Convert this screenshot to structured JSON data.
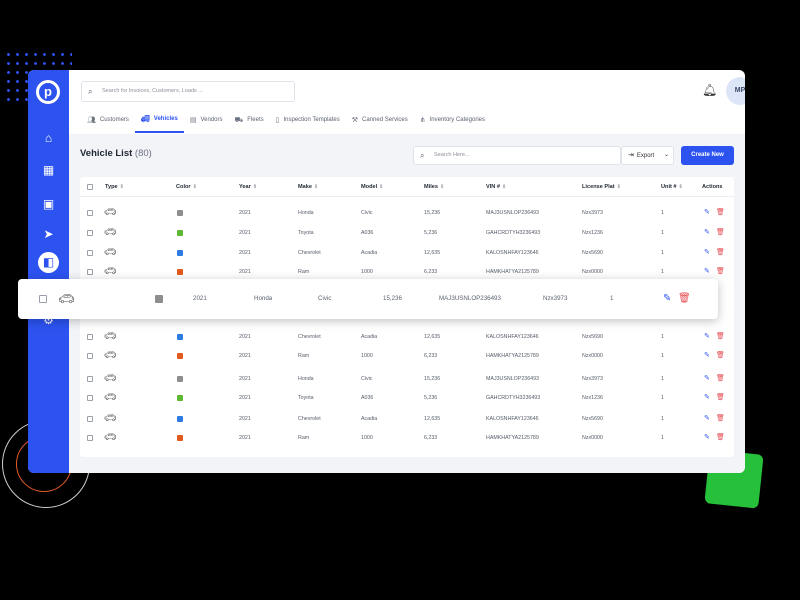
{
  "search": {
    "placeholder": "Search for Invoices, Customers, Loads ..."
  },
  "header": {
    "avatar_initials": "MP"
  },
  "tabs": [
    {
      "label": "Customers",
      "icon": "customers-icon"
    },
    {
      "label": "Vehicles",
      "icon": "vehicle-icon"
    },
    {
      "label": "Vendors",
      "icon": "vendors-icon"
    },
    {
      "label": "Fleets",
      "icon": "fleets-icon"
    },
    {
      "label": "Inspection Templates",
      "icon": "clipboard-icon"
    },
    {
      "label": "Canned Services",
      "icon": "services-icon"
    },
    {
      "label": "Inventory Categories",
      "icon": "categories-icon"
    }
  ],
  "main": {
    "title": "Vehicle List",
    "count": "(80)",
    "search_placeholder": "Search Here...",
    "export_label": "Export",
    "create_label": "Create New"
  },
  "table": {
    "columns": [
      "Type",
      "Color",
      "Year",
      "Make",
      "Model",
      "Miles",
      "VIN #",
      "License Plat",
      "Unit #",
      "Actions"
    ],
    "rows": [
      {
        "color": "#8e8e8e",
        "year": "2021",
        "make": "Honda",
        "model": "Civic",
        "miles": "15,236",
        "vin": "MAJ3USNLOP236493",
        "plate": "Nzx3973",
        "unit": "1"
      },
      {
        "color": "#5fb832",
        "year": "2021",
        "make": "Toyota",
        "model": "A036",
        "miles": "5,236",
        "vin": "GAHCRDTYH3236493",
        "plate": "Nzx1236",
        "unit": "1"
      },
      {
        "color": "#2d7de0",
        "year": "2021",
        "make": "Chevrolet",
        "model": "Acadia",
        "miles": "12,635",
        "vin": "KALOSNHFAY123646",
        "plate": "Nzx5690",
        "unit": "1"
      },
      {
        "color": "#e05a1e",
        "year": "2021",
        "make": "Ram",
        "model": "1000",
        "miles": "6,233",
        "vin": "HAMKHATYA2125789",
        "plate": "Nzx0000",
        "unit": "1"
      },
      {
        "color": "#2d7de0",
        "year": "2021",
        "make": "Chevrolet",
        "model": "Acadia",
        "miles": "12,635",
        "vin": "KALOSNHFAY123646",
        "plate": "Nzx5690",
        "unit": "1"
      },
      {
        "color": "#e05a1e",
        "year": "2021",
        "make": "Ram",
        "model": "1000",
        "miles": "6,233",
        "vin": "HAMKHATYA2125789",
        "plate": "Nzx0000",
        "unit": "1"
      },
      {
        "color": "#8e8e8e",
        "year": "2021",
        "make": "Honda",
        "model": "Civic",
        "miles": "15,236",
        "vin": "MAJ3USNLOP236493",
        "plate": "Nzx3973",
        "unit": "1"
      },
      {
        "color": "#5fb832",
        "year": "2021",
        "make": "Toyota",
        "model": "A036",
        "miles": "5,236",
        "vin": "GAHCRDTYH3236493",
        "plate": "Nzx1236",
        "unit": "1"
      },
      {
        "color": "#2d7de0",
        "year": "2021",
        "make": "Chevrolet",
        "model": "Acadia",
        "miles": "12,635",
        "vin": "KALOSNHFAY123646",
        "plate": "Nzx5690",
        "unit": "1"
      },
      {
        "color": "#e05a1e",
        "year": "2021",
        "make": "Ram",
        "model": "1000",
        "miles": "6,233",
        "vin": "HAMKHATYA2125789",
        "plate": "Nzx0000",
        "unit": "1"
      }
    ],
    "highlight_row": {
      "color": "#8e8e8e",
      "year": "2021",
      "make": "Honda",
      "model": "Civic",
      "miles": "15,236",
      "vin": "MAJ3USNLOP236493",
      "plate": "Nzx3973",
      "unit": "1"
    }
  },
  "colors": {
    "accent": "#2c53f0",
    "delete": "#e5484d",
    "decor_green": "#27c03a"
  }
}
